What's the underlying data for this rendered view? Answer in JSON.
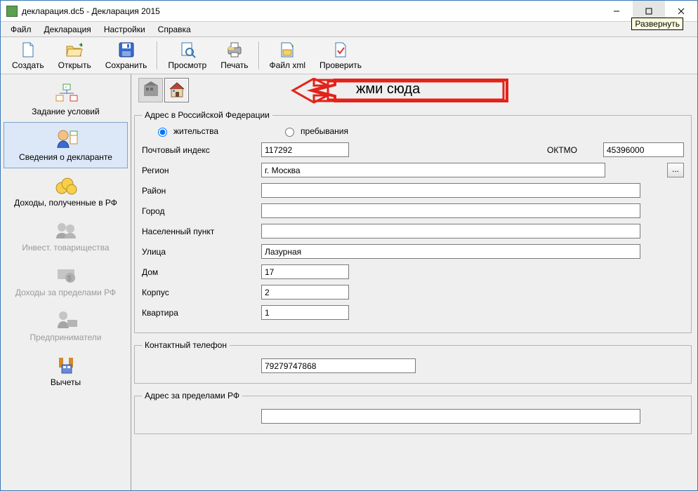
{
  "window": {
    "title": "декларация.dc5 - Декларация 2015",
    "maximize_tooltip": "Развернуть"
  },
  "menu": {
    "items": [
      "Файл",
      "Декларация",
      "Настройки",
      "Справка"
    ]
  },
  "toolbar": {
    "create": "Создать",
    "open": "Открыть",
    "save": "Сохранить",
    "preview": "Просмотр",
    "print": "Печать",
    "file_xml": "Файл xml",
    "check": "Проверить"
  },
  "sidebar": {
    "items": [
      {
        "label": "Задание условий"
      },
      {
        "label": "Сведения о декларанте"
      },
      {
        "label": "Доходы, полученные в РФ"
      },
      {
        "label": "Инвест. товарищества"
      },
      {
        "label": "Доходы за пределами РФ"
      },
      {
        "label": "Предприниматели"
      },
      {
        "label": "Вычеты"
      }
    ]
  },
  "arrow_label": "жми сюда",
  "form": {
    "group_rf": "Адрес в Российской Федерации",
    "radio_res": "жительства",
    "radio_stay": "пребывания",
    "postal_label": "Почтовый индекс",
    "postal_value": "117292",
    "oktmo_label": "ОКТМО",
    "oktmo_value": "45396000",
    "region_label": "Регион",
    "region_value": "г. Москва",
    "district_label": "Район",
    "district_value": "",
    "city_label": "Город",
    "city_value": "",
    "locality_label": "Населенный пункт",
    "locality_value": "",
    "street_label": "Улица",
    "street_value": "Лазурная",
    "house_label": "Дом",
    "house_value": "17",
    "building_label": "Корпус",
    "building_value": "2",
    "flat_label": "Квартира",
    "flat_value": "1",
    "group_phone": "Контактный телефон",
    "phone_value": "79279747868",
    "group_foreign": "Адрес за пределами РФ",
    "foreign_value": "",
    "browse": "..."
  }
}
